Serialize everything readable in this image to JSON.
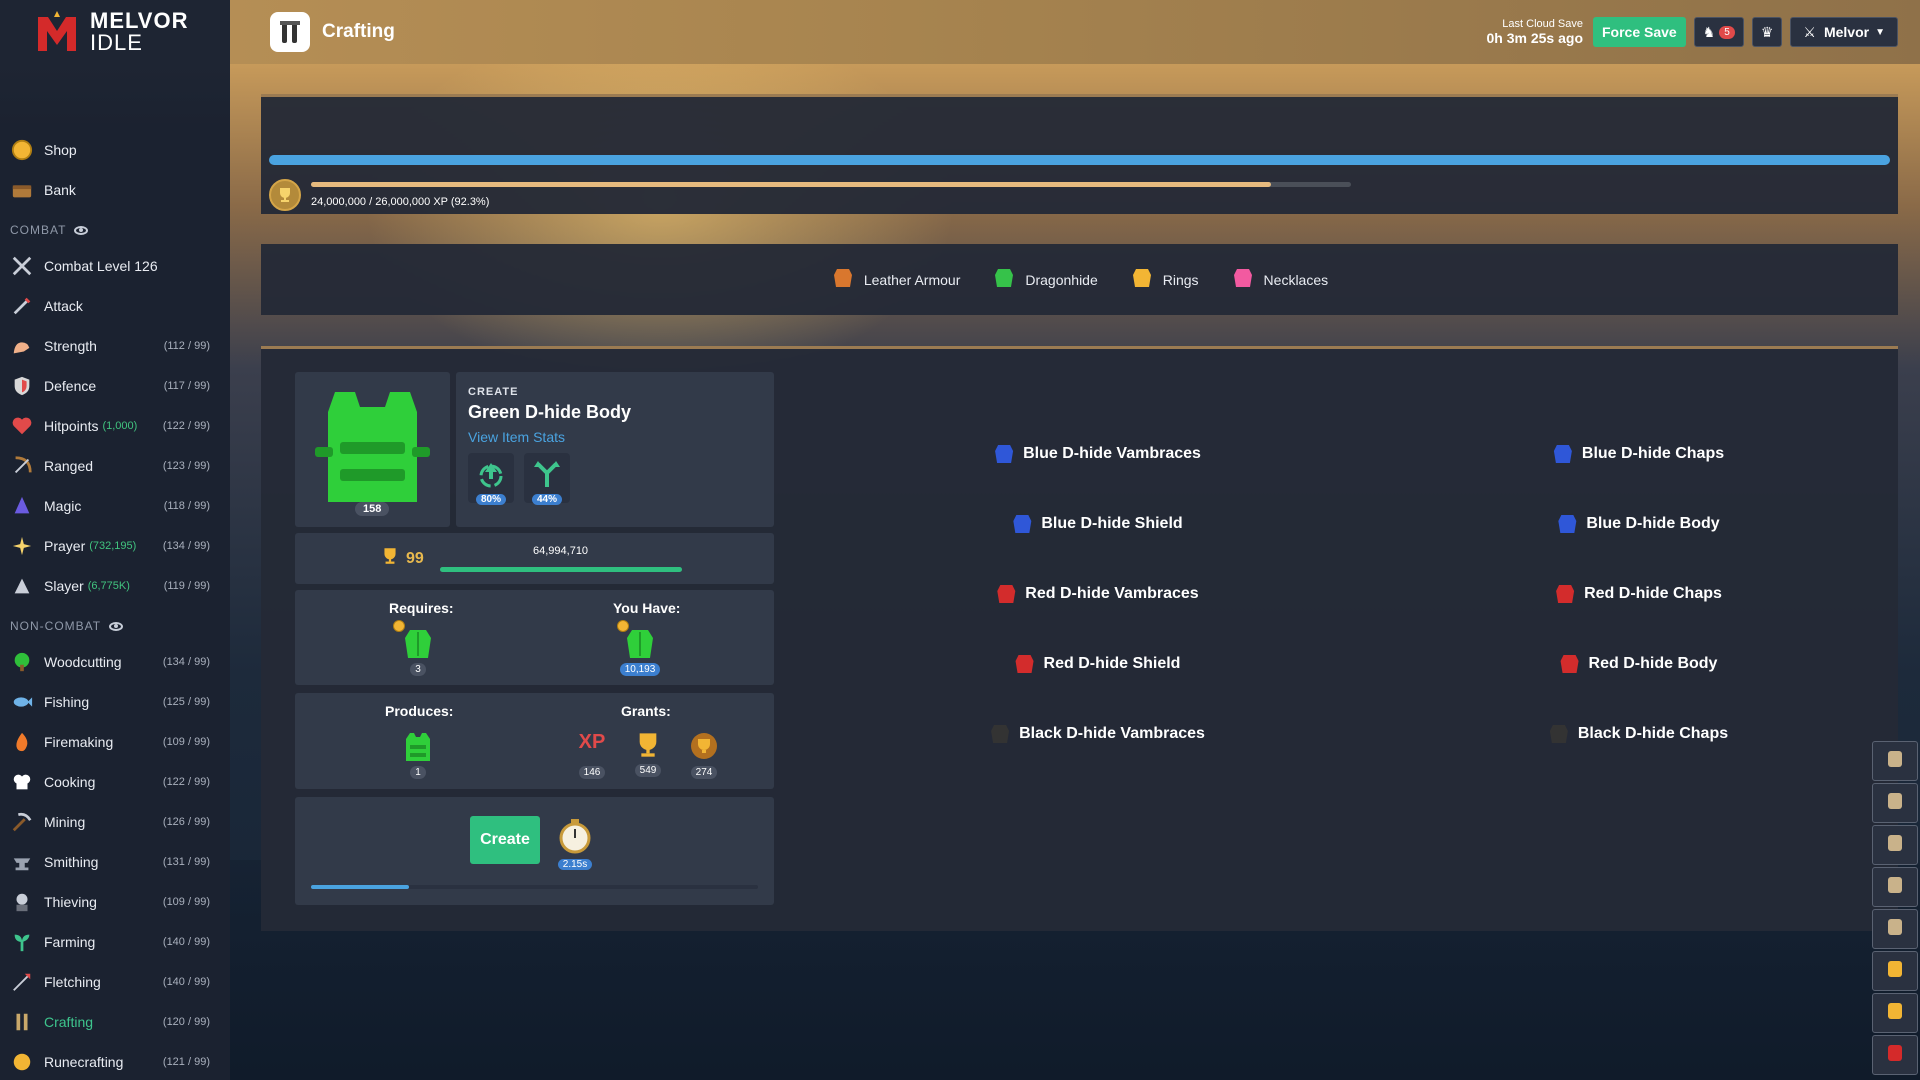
{
  "app": {
    "logo_line1": "MELVOR",
    "logo_line2": "IDLE"
  },
  "header": {
    "page_title": "Crafting",
    "cloud_label": "Last Cloud Save",
    "cloud_time": "0h 3m 25s ago",
    "force_save": "Force Save",
    "notif_count": "5",
    "user_name": "Melvor"
  },
  "sidebar": {
    "top": [
      {
        "label": "Shop",
        "icon": "coin-icon"
      },
      {
        "label": "Bank",
        "icon": "chest-icon"
      }
    ],
    "combat_title": "COMBAT",
    "combat": [
      {
        "label": "Combat Level 126",
        "extra": "",
        "level": "",
        "icon": "crossed-swords-icon"
      },
      {
        "label": "Attack",
        "extra": "",
        "level": "",
        "icon": "sword-icon"
      },
      {
        "label": "Strength",
        "extra": "",
        "level": "(112 / 99)",
        "icon": "arm-icon"
      },
      {
        "label": "Defence",
        "extra": "",
        "level": "(117 / 99)",
        "icon": "shield-icon"
      },
      {
        "label": "Hitpoints",
        "extra": "(1,000)",
        "level": "(122 / 99)",
        "icon": "heart-icon"
      },
      {
        "label": "Ranged",
        "extra": "",
        "level": "(123 / 99)",
        "icon": "bow-icon"
      },
      {
        "label": "Magic",
        "extra": "",
        "level": "(118 / 99)",
        "icon": "wizard-hat-icon"
      },
      {
        "label": "Prayer",
        "extra": "(732,195)",
        "level": "(134 / 99)",
        "icon": "star-icon"
      },
      {
        "label": "Slayer",
        "extra": "(6,775K)",
        "level": "(119 / 99)",
        "icon": "slayer-icon"
      }
    ],
    "noncombat_title": "NON-COMBAT",
    "noncombat": [
      {
        "label": "Woodcutting",
        "level": "(134 / 99)",
        "icon": "tree-icon",
        "active": false
      },
      {
        "label": "Fishing",
        "level": "(125 / 99)",
        "icon": "fish-icon",
        "active": false
      },
      {
        "label": "Firemaking",
        "level": "(109 / 99)",
        "icon": "fire-icon",
        "active": false
      },
      {
        "label": "Cooking",
        "level": "(122 / 99)",
        "icon": "chef-hat-icon",
        "active": false
      },
      {
        "label": "Mining",
        "level": "(126 / 99)",
        "icon": "pickaxe-icon",
        "active": false
      },
      {
        "label": "Smithing",
        "level": "(131 / 99)",
        "icon": "anvil-icon",
        "active": false
      },
      {
        "label": "Thieving",
        "level": "(109 / 99)",
        "icon": "thief-icon",
        "active": false
      },
      {
        "label": "Farming",
        "level": "(140 / 99)",
        "icon": "sprout-icon",
        "active": false
      },
      {
        "label": "Fletching",
        "level": "(140 / 99)",
        "icon": "arrow-icon",
        "active": false
      },
      {
        "label": "Crafting",
        "level": "(120 / 99)",
        "icon": "crafting-icon",
        "active": true
      },
      {
        "label": "Runecrafting",
        "level": "(121 / 99)",
        "icon": "rune-icon",
        "active": false
      }
    ]
  },
  "skill": {
    "xp_text": "24,000,000 / 26,000,000 XP (92.3%)",
    "xp_fraction": 0.923,
    "level_bar_fraction": 1.0
  },
  "categories": [
    {
      "label": "Leather Armour",
      "icon": "leather-icon",
      "color": "#d9772e"
    },
    {
      "label": "Dragonhide",
      "icon": "dragonhide-icon",
      "color": "#36c24a"
    },
    {
      "label": "Rings",
      "icon": "ring-icon",
      "color": "#f2b534"
    },
    {
      "label": "Necklaces",
      "icon": "necklace-icon",
      "color": "#f25aa0"
    }
  ],
  "selected": {
    "create_label": "CREATE",
    "name": "Green D-hide Body",
    "link": "View Item Stats",
    "qty": "158",
    "mod1_pct": "80%",
    "mod2_pct": "44%",
    "mastery_level": "99",
    "mastery_xp": "64,994,710",
    "mastery_fraction": 1.0,
    "requires_label": "Requires:",
    "you_have_label": "You Have:",
    "req_count": "3",
    "have_count": "10,193",
    "produces_label": "Produces:",
    "grants_label": "Grants:",
    "produce_count": "1",
    "grant_xp_text": "XP",
    "grant_xp": "146",
    "grant_mastery": "549",
    "grant_pool": "274",
    "create_button": "Create",
    "time": "2.15s",
    "progress_fraction": 0.22
  },
  "recipes_left": [
    {
      "label": "Blue D-hide Vambraces",
      "color": "#2f57d8"
    },
    {
      "label": "Blue D-hide Shield",
      "color": "#2f57d8"
    },
    {
      "label": "Red D-hide Vambraces",
      "color": "#d32c2c"
    },
    {
      "label": "Red D-hide Shield",
      "color": "#d32c2c"
    },
    {
      "label": "Black D-hide Vambraces",
      "color": "#333"
    }
  ],
  "recipes_right": [
    {
      "label": "Blue D-hide Chaps",
      "color": "#2f57d8"
    },
    {
      "label": "Blue D-hide Body",
      "color": "#2f57d8"
    },
    {
      "label": "Red D-hide Chaps",
      "color": "#d32c2c"
    },
    {
      "label": "Red D-hide Body",
      "color": "#d32c2c"
    },
    {
      "label": "Black D-hide Chaps",
      "color": "#333"
    }
  ],
  "toolbar_icons": [
    "arrows-icon",
    "potion-icon",
    "bag-icon",
    "armour-icon",
    "wolf-icon",
    "medal-icon",
    "trophy-icon",
    "melvor-logo-icon"
  ],
  "colors": {
    "accent_green": "#2fbf7f",
    "xp_blue": "#4aa3e0",
    "gold": "#e8b94e"
  }
}
